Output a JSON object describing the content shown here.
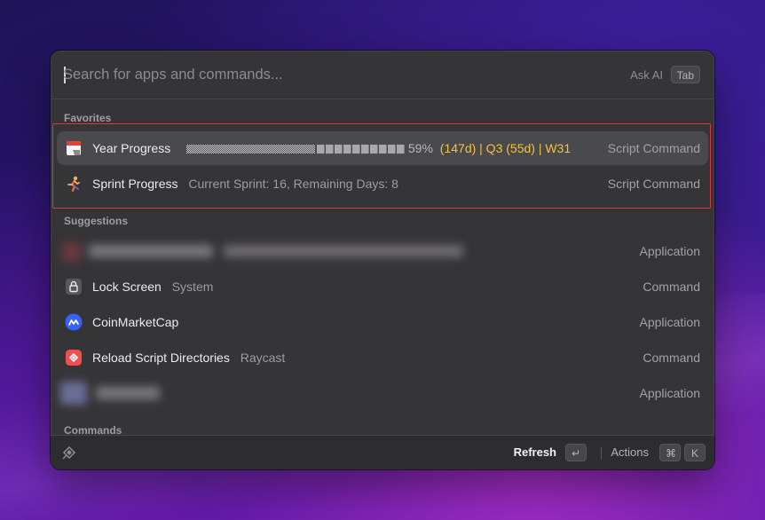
{
  "search": {
    "placeholder": "Search for apps and commands...",
    "ask_ai_label": "Ask AI",
    "tab_key": "Tab"
  },
  "sections": {
    "favorites": "Favorites",
    "suggestions": "Suggestions",
    "commands": "Commands"
  },
  "favorites": [
    {
      "title": "Year Progress",
      "progress_fraction": 0.59,
      "percent": "59%",
      "detail": "(147d) | Q3 (55d) | W31",
      "type": "Script Command",
      "icon": "calendar-icon",
      "detail_color": "#f5c33b"
    },
    {
      "title": "Sprint Progress",
      "subtitle": "Current Sprint: 16, Remaining Days: 8",
      "type": "Script Command",
      "icon": "runner-icon"
    }
  ],
  "suggestions": [
    {
      "title": "",
      "type": "Application",
      "icon": "redacted-app-icon"
    },
    {
      "title": "Lock Screen",
      "subtitle": "System",
      "type": "Command",
      "icon": "lock-icon"
    },
    {
      "title": "CoinMarketCap",
      "type": "Application",
      "icon": "coinmarketcap-icon"
    },
    {
      "title": "Reload Script Directories",
      "subtitle": "Raycast",
      "type": "Command",
      "icon": "raycast-icon"
    },
    {
      "title": "",
      "type": "Application",
      "icon": "redacted-app-icon"
    }
  ],
  "footer": {
    "primary_action": "Refresh",
    "enter_key": "↵",
    "actions_label": "Actions",
    "cmd_key": "⌘",
    "k_key": "K"
  },
  "colors": {
    "accent_yellow": "#f5c33b",
    "highlight_border": "#d9393f",
    "window_bg": "#353437"
  }
}
